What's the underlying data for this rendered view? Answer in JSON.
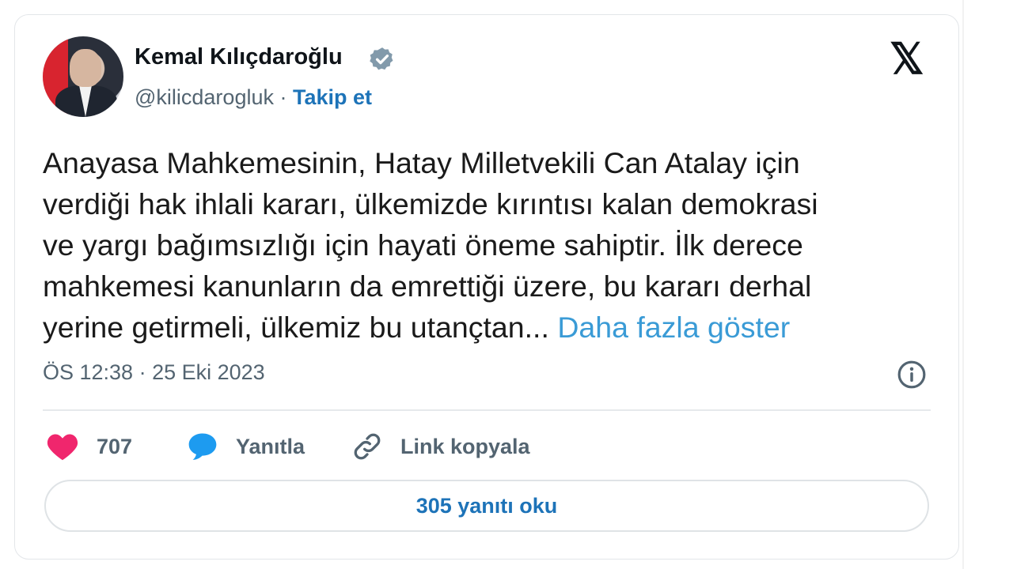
{
  "author": {
    "name": "Kemal Kılıçdaroğlu",
    "handle": "@kilicdarogluk",
    "separator": " · ",
    "follow_label": "Takip et"
  },
  "tweet": {
    "lines": [
      "Anayasa Mahkemesinin, Hatay Milletvekili Can Atalay için",
      "verdiği hak ihlali kararı, ülkemizde kırıntısı kalan demokrasi",
      "ve yargı bağımsızlığı için hayati öneme sahiptir. İlk derece",
      "mahkemesi kanunların da emrettiği üzere, bu kararı derhal",
      "yerine getirmeli, ülkemiz bu utançtan..."
    ],
    "show_more": "Daha fazla göster"
  },
  "timestamp": "ÖS 12:38 · 25 Eki 2023",
  "actions": {
    "likes": "707",
    "reply": "Yanıtla",
    "copy_link": "Link kopyala"
  },
  "read_replies": "305 yanıtı oku",
  "colors": {
    "like": "#f0266d",
    "reply": "#1d9bf0",
    "link": "#1d73b8",
    "show_more": "#3a9bd6",
    "verified": "#829aab"
  }
}
